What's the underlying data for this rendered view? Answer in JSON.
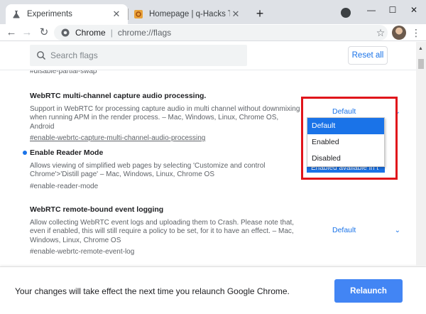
{
  "browser": {
    "tabs": [
      {
        "title": "Experiments",
        "favicon": "flask-icon",
        "active": true
      },
      {
        "title": "Homepage | q-Hacks Technology",
        "favicon": "q-hacks-logo",
        "active": false
      }
    ],
    "address": {
      "site_label": "Chrome",
      "url": "chrome://flags"
    }
  },
  "flags_page": {
    "search_placeholder": "Search flags",
    "reset_label": "Reset all",
    "partial_above": "#disable-partial-swap",
    "features": [
      {
        "name": "WebRTC multi-channel capture audio processing.",
        "description": "Support in WebRTC for processing capture audio in multi channel without downmixing when running APM in the render process. – Mac, Windows, Linux, Chrome OS, Android",
        "tag": "#enable-webrtc-capture-multi-channel-audio-processing",
        "selected": "Default",
        "modified": false
      },
      {
        "name": "Enable Reader Mode",
        "description": "Allows viewing of simplified web pages by selecting 'Customize and control Chrome'>'Distill page' – Mac, Windows, Linux, Chrome OS",
        "tag": "#enable-reader-mode",
        "selected": "Enabled available in t",
        "modified": true
      },
      {
        "name": "WebRTC remote-bound event logging",
        "description": "Allow collecting WebRTC event logs and uploading them to Crash. Please note that, even if enabled, this will still require a policy to be set, for it to have an effect. – Mac, Windows, Linux, Chrome OS",
        "tag": "#enable-webrtc-remote-event-log",
        "selected": "Default",
        "modified": false
      }
    ],
    "dropdown_options": [
      "Default",
      "Enabled",
      "Disabled"
    ],
    "dropdown_highlighted": "Default"
  },
  "relaunch": {
    "message": "Your changes will take effect the next time you relaunch Google Chrome.",
    "button": "Relaunch"
  },
  "colors": {
    "accent": "#1a73e8",
    "relaunch_button": "#4285f4",
    "annotation": "#e0151b"
  }
}
